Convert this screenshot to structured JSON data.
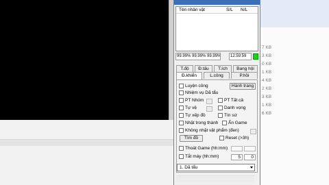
{
  "panel": {
    "title": "",
    "list_headers": [
      "Tên nhân vật",
      "S/L",
      "N/L"
    ],
    "stats": [
      "99.99% 99.99% 99.99%/h",
      "12:59:59"
    ],
    "status_color": "#16d616",
    "tabs_row1": [
      "T.độ",
      "Đ.tấu",
      "T.ích",
      "Bang hội"
    ],
    "tabs_row2": [
      "Đ.khiển",
      "L.công",
      "P.hồi"
    ],
    "active_tab": "Đ.khiển",
    "checks": {
      "luyen_cong": "Luyện công",
      "nhiem_vu": "Nhiệm vụ Dã tẩu",
      "pt_nhom": "PT Nhóm",
      "pt_tat_ca": "PT Tất cả",
      "tu_ve": "Tự vệ",
      "danh_vong": "Danh vọng",
      "tu_xep_do": "Tự xếp đồ",
      "tin_su": "Tín sứ",
      "nhat_trong_thanh": "Nhặt trong thành",
      "an_game": "Ẩn Game",
      "khong_nhat": "Không nhặt vật phẩm (đen)",
      "reset": "Reset (>3h)",
      "thoat_game": "Thoát Game (hh:mm)",
      "tat_may": "Tắt máy (hh:mm)"
    },
    "buttons": {
      "hanh_trang": "Hành trang",
      "tim_do": "Tìm đồ"
    },
    "tat_may_values": [
      "5",
      "0"
    ],
    "dropdown_selected": "1. Dã tẩu"
  },
  "right_sizes": [
    "7 KB",
    "3 KB",
    "0 KB",
    "1 KB",
    "4 KB",
    "2 KB",
    "3 KB",
    "1 KB",
    "6 KB"
  ]
}
